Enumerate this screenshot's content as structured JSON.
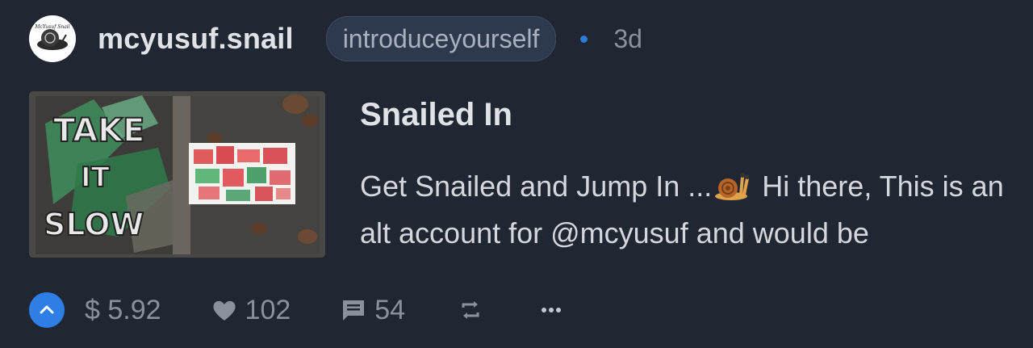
{
  "post": {
    "author": "mcyusuf.snail",
    "community": "introduceyourself",
    "age": "3d",
    "title": "Snailed In",
    "excerpt_before": "Get Snailed and Jump In ...",
    "excerpt_after": " Hi there, This is an alt account for @mcyusuf and would be",
    "thumbnail_text": [
      "TAKE",
      "IT",
      "SLOW"
    ]
  },
  "footer": {
    "payout": "$ 5.92",
    "likes": "102",
    "comments": "54"
  },
  "colors": {
    "background": "#212633",
    "accent": "#2e7ee6",
    "muted": "#8a919c"
  },
  "icons": {
    "vote": "chevron-up-icon",
    "likes": "heart-icon",
    "comments": "comment-icon",
    "reblog": "reblog-icon",
    "more": "ellipsis-icon"
  }
}
